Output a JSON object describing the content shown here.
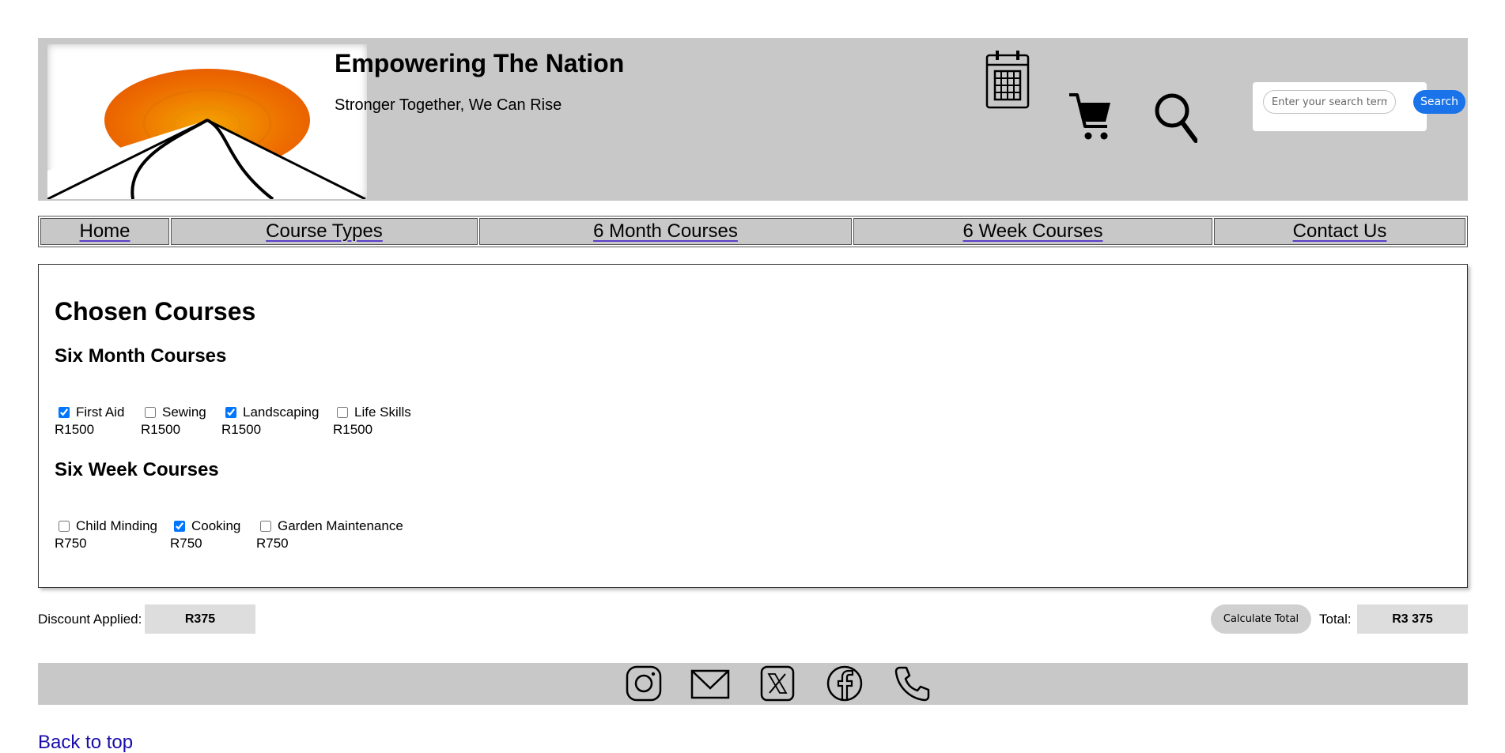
{
  "header": {
    "title": "Empowering The Nation",
    "tagline": "Stronger Together, We Can Rise",
    "icons": [
      "calendar-icon",
      "cart-icon",
      "search-icon"
    ],
    "search_placeholder": "Enter your search term...",
    "search_button": "Search"
  },
  "nav": {
    "items": [
      {
        "label": "Home"
      },
      {
        "label": "Course Types"
      },
      {
        "label": "6 Month Courses"
      },
      {
        "label": "6 Week Courses"
      },
      {
        "label": "Contact Us"
      }
    ]
  },
  "main": {
    "title": "Chosen Courses",
    "six_month": {
      "heading": "Six Month Courses",
      "courses": [
        {
          "name": "First Aid",
          "price": "R1500",
          "checked": true
        },
        {
          "name": "Sewing",
          "price": "R1500",
          "checked": false
        },
        {
          "name": "Landscaping",
          "price": "R1500",
          "checked": true
        },
        {
          "name": "Life Skills",
          "price": "R1500",
          "checked": false
        }
      ]
    },
    "six_week": {
      "heading": "Six Week Courses",
      "courses": [
        {
          "name": "Child Minding",
          "price": "R750",
          "checked": false
        },
        {
          "name": "Cooking",
          "price": "R750",
          "checked": true
        },
        {
          "name": "Garden Maintenance",
          "price": "R750",
          "checked": false
        }
      ]
    }
  },
  "totals": {
    "discount_label": "Discount Applied:",
    "discount_value": "R375",
    "calculate_button": "Calculate Total",
    "total_label": "Total:",
    "total_value": "R3 375"
  },
  "footer": {
    "icons": [
      "instagram-icon",
      "email-icon",
      "x-icon",
      "facebook-icon",
      "phone-icon"
    ]
  },
  "back_link": "Back to top",
  "colors": {
    "header_bg": "#c8c8c8",
    "accent_blue": "#1a73e8",
    "value_box_bg": "#dddddd"
  }
}
